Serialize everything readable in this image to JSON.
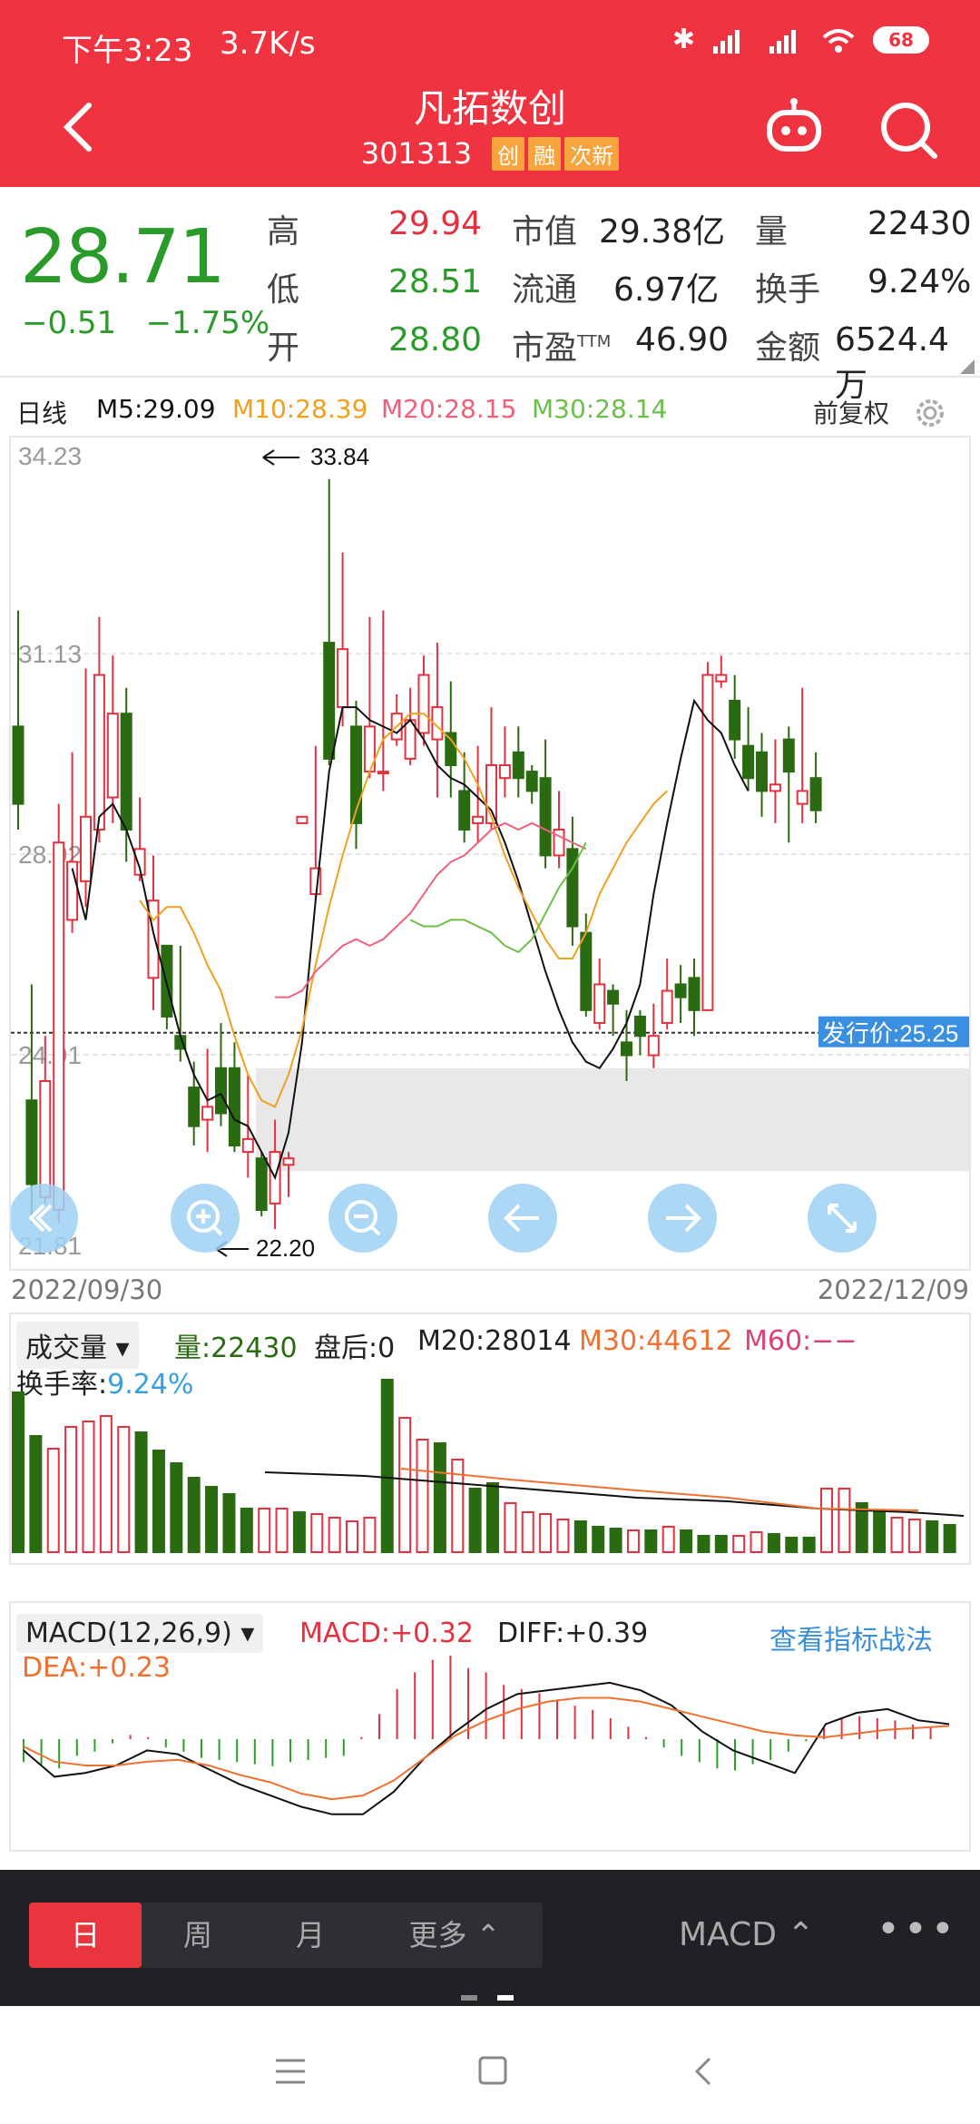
{
  "status": {
    "time": "下午3:23",
    "speed": "3.7K/s",
    "battery": "68"
  },
  "header": {
    "title": "凡拓数创",
    "code": "301313",
    "tags": [
      "创",
      "融",
      "次新"
    ]
  },
  "quote": {
    "price": "28.71",
    "change": "−0.51",
    "change_pct": "−1.75%",
    "rows": [
      {
        "l1": "高",
        "v1": "29.94",
        "l2": "市值",
        "v2": "29.38亿",
        "l3": "量",
        "v3": "22430"
      },
      {
        "l1": "低",
        "v1": "28.51",
        "l2": "流通",
        "v2": "6.97亿",
        "l3": "换手",
        "v3": "9.24%"
      },
      {
        "l1": "开",
        "v1": "28.80",
        "l2": "市盈",
        "l2sup": "TTM",
        "v2": "46.90",
        "l3": "金额",
        "v3": "6524.4万"
      }
    ]
  },
  "indicators": {
    "period": "日线",
    "m5": "M5:29.09",
    "m10": "M10:28.39",
    "m20": "M20:28.15",
    "m30": "M30:28.14",
    "adjust": "前复权"
  },
  "colors": {
    "up": "#e3313f",
    "down": "#2a6b12",
    "m5": "#111111",
    "m10": "#f0a020",
    "m20": "#f0607a",
    "m30": "#6cc04a",
    "macd": "#f07030"
  },
  "chart_data": {
    "type": "candlestick",
    "y_ticks": [
      "34.23",
      "31.13",
      "28.02",
      "24.91",
      "21.81"
    ],
    "ylim": [
      21.81,
      34.23
    ],
    "dates": [
      "2022/09/30",
      "2022/12/09"
    ],
    "max_label": "33.84",
    "min_label": "22.20",
    "issue_label": "发行价:25.25",
    "issue_price": 25.25,
    "candles": [
      [
        30.0,
        28.8,
        31.8,
        28.4
      ],
      [
        24.2,
        22.9,
        26.0,
        22.3
      ],
      [
        22.7,
        24.5,
        25.2,
        22.6
      ],
      [
        22.5,
        28.2,
        28.8,
        22.3
      ],
      [
        27.0,
        27.9,
        29.6,
        26.8
      ],
      [
        27.6,
        28.6,
        30.9,
        27.2
      ],
      [
        28.4,
        30.8,
        31.7,
        28.2
      ],
      [
        28.9,
        30.2,
        31.1,
        28.5
      ],
      [
        30.2,
        28.4,
        30.6,
        27.9
      ],
      [
        27.7,
        28.1,
        28.9,
        27.6
      ],
      [
        26.1,
        27.3,
        28.0,
        25.6
      ],
      [
        26.6,
        25.5,
        26.6,
        25.3
      ],
      [
        25.2,
        25.0,
        26.6,
        24.8
      ],
      [
        24.4,
        23.8,
        24.8,
        23.5
      ],
      [
        23.9,
        24.1,
        25.0,
        23.4
      ],
      [
        24.7,
        24.0,
        25.4,
        23.8
      ],
      [
        24.7,
        23.5,
        25.1,
        23.4
      ],
      [
        23.4,
        23.6,
        24.6,
        23.0
      ],
      [
        23.3,
        22.5,
        23.4,
        22.4
      ],
      [
        22.6,
        23.4,
        23.9,
        22.2
      ],
      [
        23.2,
        23.3,
        23.4,
        22.7
      ],
      [
        28.5,
        28.6,
        28.6,
        28.5
      ],
      [
        27.4,
        27.8,
        29.7,
        27.3
      ],
      [
        31.3,
        29.5,
        33.84,
        29.4
      ],
      [
        30.3,
        31.2,
        32.7,
        30.0
      ],
      [
        30.0,
        28.5,
        30.4,
        28.1
      ],
      [
        29.3,
        30.0,
        31.7,
        29.2
      ],
      [
        29.3,
        29.3,
        31.8,
        29.0
      ],
      [
        29.8,
        30.2,
        30.5,
        29.7
      ],
      [
        29.5,
        30.1,
        30.6,
        29.4
      ],
      [
        29.9,
        30.8,
        31.1,
        29.7
      ],
      [
        29.8,
        30.3,
        31.3,
        28.9
      ],
      [
        29.9,
        29.4,
        30.7,
        28.9
      ],
      [
        29.0,
        28.4,
        29.6,
        28.2
      ],
      [
        28.5,
        28.6,
        29.7,
        28.2
      ],
      [
        28.5,
        29.4,
        30.3,
        28.4
      ],
      [
        29.2,
        29.4,
        30.0,
        28.9
      ],
      [
        29.6,
        29.2,
        30.0,
        28.9
      ],
      [
        29.3,
        29.0,
        29.4,
        28.8
      ],
      [
        29.2,
        28.0,
        29.8,
        27.8
      ],
      [
        28.0,
        28.4,
        29.0,
        27.8
      ],
      [
        28.1,
        26.9,
        28.6,
        26.6
      ],
      [
        26.8,
        25.6,
        27.1,
        25.5
      ],
      [
        25.4,
        26.0,
        26.4,
        25.3
      ],
      [
        25.9,
        25.7,
        26.0,
        25.2
      ],
      [
        25.1,
        24.9,
        25.6,
        24.5
      ],
      [
        25.5,
        25.2,
        25.6,
        24.9
      ],
      [
        24.9,
        25.2,
        25.7,
        24.7
      ],
      [
        25.4,
        25.9,
        26.4,
        25.3
      ],
      [
        26.0,
        25.8,
        26.3,
        25.4
      ],
      [
        26.1,
        25.6,
        26.4,
        25.2
      ],
      [
        25.6,
        30.8,
        31.0,
        25.6
      ],
      [
        30.7,
        30.8,
        31.1,
        30.6
      ],
      [
        30.4,
        29.8,
        30.8,
        29.5
      ],
      [
        29.7,
        29.2,
        30.3,
        29.0
      ],
      [
        29.6,
        29.0,
        29.9,
        28.6
      ],
      [
        29.0,
        29.1,
        29.8,
        28.5
      ],
      [
        29.8,
        29.3,
        30.0,
        28.2
      ],
      [
        28.8,
        29.0,
        30.6,
        28.5
      ],
      [
        29.2,
        28.7,
        29.6,
        28.5
      ]
    ],
    "ma": {
      "M5": [
        [
          4,
          27.8
        ],
        [
          5,
          27.0
        ],
        [
          6,
          28.6
        ],
        [
          7,
          28.8
        ],
        [
          8,
          28.4
        ],
        [
          9,
          27.8
        ],
        [
          10,
          26.8
        ],
        [
          11,
          26.0
        ],
        [
          12,
          25.2
        ],
        [
          13,
          24.6
        ],
        [
          14,
          24.2
        ],
        [
          15,
          24.3
        ],
        [
          16,
          23.9
        ],
        [
          17,
          23.8
        ],
        [
          18,
          23.4
        ],
        [
          19,
          23.0
        ],
        [
          20,
          23.7
        ],
        [
          21,
          25.1
        ],
        [
          22,
          27.3
        ],
        [
          23,
          29.3
        ],
        [
          24,
          30.3
        ],
        [
          25,
          30.3
        ],
        [
          26,
          30.1
        ],
        [
          27,
          30.0
        ],
        [
          28,
          29.9
        ],
        [
          29,
          30.1
        ],
        [
          30,
          29.8
        ],
        [
          31,
          29.4
        ],
        [
          32,
          29.2
        ],
        [
          33,
          29.1
        ],
        [
          34,
          28.9
        ],
        [
          35,
          28.7
        ],
        [
          36,
          28.2
        ],
        [
          37,
          27.6
        ],
        [
          38,
          26.9
        ],
        [
          39,
          26.2
        ],
        [
          40,
          25.6
        ],
        [
          41,
          25.1
        ],
        [
          42,
          24.8
        ],
        [
          43,
          24.7
        ],
        [
          44,
          25.0
        ],
        [
          45,
          25.4
        ],
        [
          46,
          26.0
        ],
        [
          47,
          27.4
        ],
        [
          48,
          28.5
        ],
        [
          49,
          29.5
        ],
        [
          50,
          30.4
        ],
        [
          51,
          30.1
        ],
        [
          52,
          29.9
        ],
        [
          53,
          29.4
        ],
        [
          54,
          29.0
        ]
      ],
      "M10": [
        [
          9,
          27.3
        ],
        [
          10,
          27.0
        ],
        [
          11,
          27.2
        ],
        [
          12,
          27.2
        ],
        [
          13,
          26.8
        ],
        [
          14,
          26.3
        ],
        [
          15,
          25.9
        ],
        [
          16,
          25.2
        ],
        [
          17,
          24.6
        ],
        [
          18,
          24.2
        ],
        [
          19,
          24.1
        ],
        [
          20,
          24.6
        ],
        [
          21,
          25.3
        ],
        [
          22,
          26.3
        ],
        [
          23,
          27.2
        ],
        [
          24,
          28.0
        ],
        [
          25,
          28.7
        ],
        [
          26,
          29.3
        ],
        [
          27,
          29.8
        ],
        [
          28,
          30.0
        ],
        [
          29,
          30.2
        ],
        [
          30,
          30.2
        ],
        [
          31,
          30.0
        ],
        [
          32,
          29.8
        ],
        [
          33,
          29.5
        ],
        [
          34,
          29.1
        ],
        [
          35,
          28.6
        ],
        [
          36,
          28.0
        ],
        [
          37,
          27.5
        ],
        [
          38,
          27.1
        ],
        [
          39,
          26.7
        ],
        [
          40,
          26.4
        ],
        [
          41,
          26.4
        ],
        [
          42,
          26.8
        ],
        [
          43,
          27.4
        ],
        [
          44,
          27.8
        ],
        [
          45,
          28.2
        ],
        [
          46,
          28.5
        ],
        [
          47,
          28.8
        ],
        [
          48,
          29.0
        ]
      ],
      "M20": [
        [
          19,
          25.8
        ],
        [
          20,
          25.8
        ],
        [
          21,
          25.9
        ],
        [
          22,
          26.2
        ],
        [
          23,
          26.4
        ],
        [
          24,
          26.6
        ],
        [
          25,
          26.7
        ],
        [
          26,
          26.6
        ],
        [
          27,
          26.7
        ],
        [
          28,
          26.9
        ],
        [
          29,
          27.1
        ],
        [
          30,
          27.4
        ],
        [
          31,
          27.7
        ],
        [
          32,
          27.9
        ],
        [
          33,
          28.0
        ],
        [
          34,
          28.2
        ],
        [
          35,
          28.4
        ],
        [
          36,
          28.5
        ],
        [
          37,
          28.4
        ],
        [
          38,
          28.5
        ],
        [
          39,
          28.4
        ],
        [
          40,
          28.3
        ],
        [
          41,
          28.2
        ],
        [
          42,
          28.1
        ]
      ],
      "M30": [
        [
          29,
          27.0
        ],
        [
          30,
          26.9
        ],
        [
          31,
          26.9
        ],
        [
          32,
          27.0
        ],
        [
          33,
          27.0
        ],
        [
          34,
          26.9
        ],
        [
          35,
          26.8
        ],
        [
          36,
          26.6
        ],
        [
          37,
          26.5
        ],
        [
          38,
          26.7
        ],
        [
          39,
          27.1
        ],
        [
          40,
          27.5
        ],
        [
          41,
          27.8
        ],
        [
          42,
          28.2
        ]
      ]
    }
  },
  "volume": {
    "selector": "成交量",
    "vol": "量:22430",
    "after": "盘后:0",
    "m20": "M20:28014",
    "m30": "M30:44612",
    "m60": "M60:−−",
    "turnover_label": "换手率:",
    "turnover": "9.24%",
    "bars": [
      0.88,
      0.64,
      0.57,
      0.69,
      0.72,
      0.75,
      0.69,
      0.66,
      0.56,
      0.49,
      0.41,
      0.36,
      0.32,
      0.24,
      0.24,
      0.24,
      0.22,
      0.21,
      0.19,
      0.17,
      0.19,
      0.95,
      0.74,
      0.62,
      0.6,
      0.51,
      0.35,
      0.38,
      0.27,
      0.22,
      0.21,
      0.18,
      0.17,
      0.14,
      0.13,
      0.12,
      0.12,
      0.14,
      0.12,
      0.09,
      0.09,
      0.09,
      0.11,
      0.1,
      0.08,
      0.08,
      0.35,
      0.35,
      0.27,
      0.22,
      0.19,
      0.18,
      0.17,
      0.15
    ],
    "bar_up": [
      0,
      0,
      1,
      1,
      1,
      1,
      1,
      0,
      0,
      0,
      0,
      0,
      0,
      0,
      1,
      1,
      0,
      1,
      1,
      1,
      1,
      0,
      1,
      1,
      0,
      1,
      0,
      0,
      1,
      1,
      1,
      1,
      0,
      0,
      0,
      1,
      0,
      1,
      0,
      0,
      0,
      1,
      1,
      0,
      0,
      0,
      1,
      1,
      0,
      0,
      1,
      1,
      0,
      0
    ]
  },
  "macd": {
    "selector": "MACD(12,26,9)",
    "macd": "MACD:+0.32",
    "diff": "DIFF:+0.39",
    "dea": "DEA:+0.23",
    "link": "查看指标战法",
    "hist": [
      -0.55,
      -0.6,
      -0.7,
      -0.4,
      -0.3,
      -0.1,
      0.1,
      0.05,
      -0.2,
      -0.3,
      -0.45,
      -0.5,
      -0.55,
      -0.6,
      -0.65,
      -0.55,
      -0.5,
      -0.45,
      -0.4,
      0.05,
      0.6,
      1.2,
      1.6,
      1.9,
      2.0,
      1.7,
      1.6,
      1.3,
      1.2,
      1.1,
      0.95,
      0.8,
      0.7,
      0.5,
      0.3,
      0.05,
      -0.2,
      -0.4,
      -0.55,
      -0.7,
      -0.75,
      -0.6,
      -0.5,
      -0.3,
      -0.05,
      0.3,
      0.5,
      0.55,
      0.5,
      0.45,
      0.35,
      0.3
    ],
    "diff_line": [
      -0.3,
      -1.0,
      -0.9,
      -0.7,
      -0.3,
      -0.4,
      -0.8,
      -1.2,
      -1.5,
      -1.8,
      -2.0,
      -2.0,
      -1.4,
      -0.5,
      0.2,
      0.8,
      1.2,
      1.3,
      1.4,
      1.5,
      1.3,
      0.9,
      0.2,
      -0.3,
      -0.6,
      -0.9,
      0.4,
      0.7,
      0.8,
      0.5,
      0.4
    ],
    "dea_line": [
      -0.2,
      -0.6,
      -0.7,
      -0.7,
      -0.6,
      -0.55,
      -0.7,
      -0.95,
      -1.15,
      -1.45,
      -1.6,
      -1.5,
      -1.1,
      -0.5,
      0.1,
      0.5,
      0.8,
      1.0,
      1.1,
      1.1,
      1.0,
      0.8,
      0.6,
      0.4,
      0.2,
      0.1,
      0.05,
      0.15,
      0.25,
      0.3,
      0.35
    ]
  },
  "bottom": {
    "day": "日",
    "week": "周",
    "month": "月",
    "more": "更多 ⌃",
    "macd": "MACD ⌃",
    "dots": "•••"
  }
}
